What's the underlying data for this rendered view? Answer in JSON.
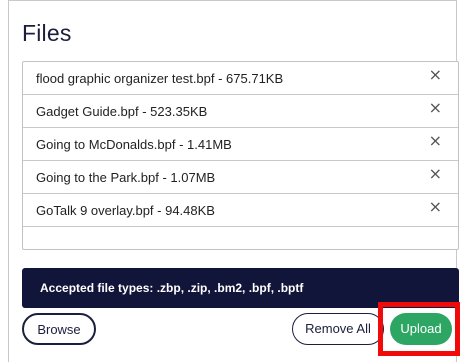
{
  "panel": {
    "title": "Files"
  },
  "files": [
    {
      "label": "flood graphic organizer test.bpf - 675.71KB",
      "remove_icon": "×"
    },
    {
      "label": "Gadget Guide.bpf - 523.35KB",
      "remove_icon": "×"
    },
    {
      "label": "Going to McDonalds.bpf - 1.41MB",
      "remove_icon": "×"
    },
    {
      "label": "Going to the Park.bpf - 1.07MB",
      "remove_icon": "×"
    },
    {
      "label": "GoTalk 9 overlay.bpf - 94.48KB",
      "remove_icon": "×"
    }
  ],
  "accepted": {
    "text": "Accepted file types: .zbp, .zip, .bm2, .bpf, .bptf"
  },
  "buttons": {
    "browse": "Browse",
    "remove_all": "Remove All",
    "upload": "Upload"
  },
  "colors": {
    "navy": "#12153a",
    "upload_green": "#2da664",
    "highlight_red": "#f00a0a"
  }
}
